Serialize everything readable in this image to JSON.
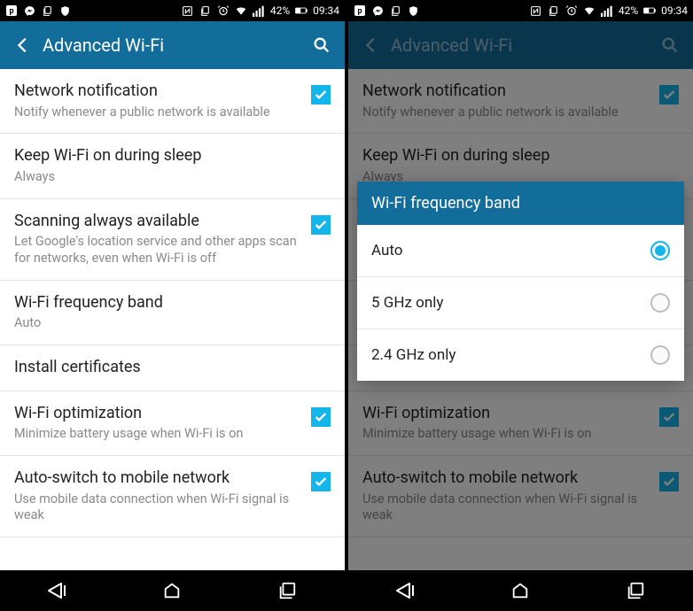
{
  "statusbar": {
    "battery_text": "42%",
    "time": "09:34"
  },
  "appbar": {
    "title": "Advanced Wi-Fi"
  },
  "settings": [
    {
      "title": "Network notification",
      "sub": "Notify whenever a public network is available",
      "checked": true
    },
    {
      "title": "Keep Wi-Fi on during sleep",
      "sub": "Always",
      "checked": null
    },
    {
      "title": "Scanning always available",
      "sub": "Let Google's location service and other apps scan for networks, even when Wi-Fi is off",
      "checked": true
    },
    {
      "title": "Wi-Fi frequency band",
      "sub": "Auto",
      "checked": null
    },
    {
      "title": "Install certificates",
      "sub": "",
      "checked": null
    },
    {
      "title": "Wi-Fi optimization",
      "sub": "Minimize battery usage when Wi-Fi is on",
      "checked": true
    },
    {
      "title": "Auto-switch to mobile network",
      "sub": "Use mobile data connection when Wi-Fi signal is weak",
      "checked": true
    }
  ],
  "dialog": {
    "title": "Wi-Fi frequency band",
    "options": [
      {
        "label": "Auto",
        "selected": true
      },
      {
        "label": "5 GHz only",
        "selected": false
      },
      {
        "label": "2.4 GHz only",
        "selected": false
      }
    ]
  }
}
